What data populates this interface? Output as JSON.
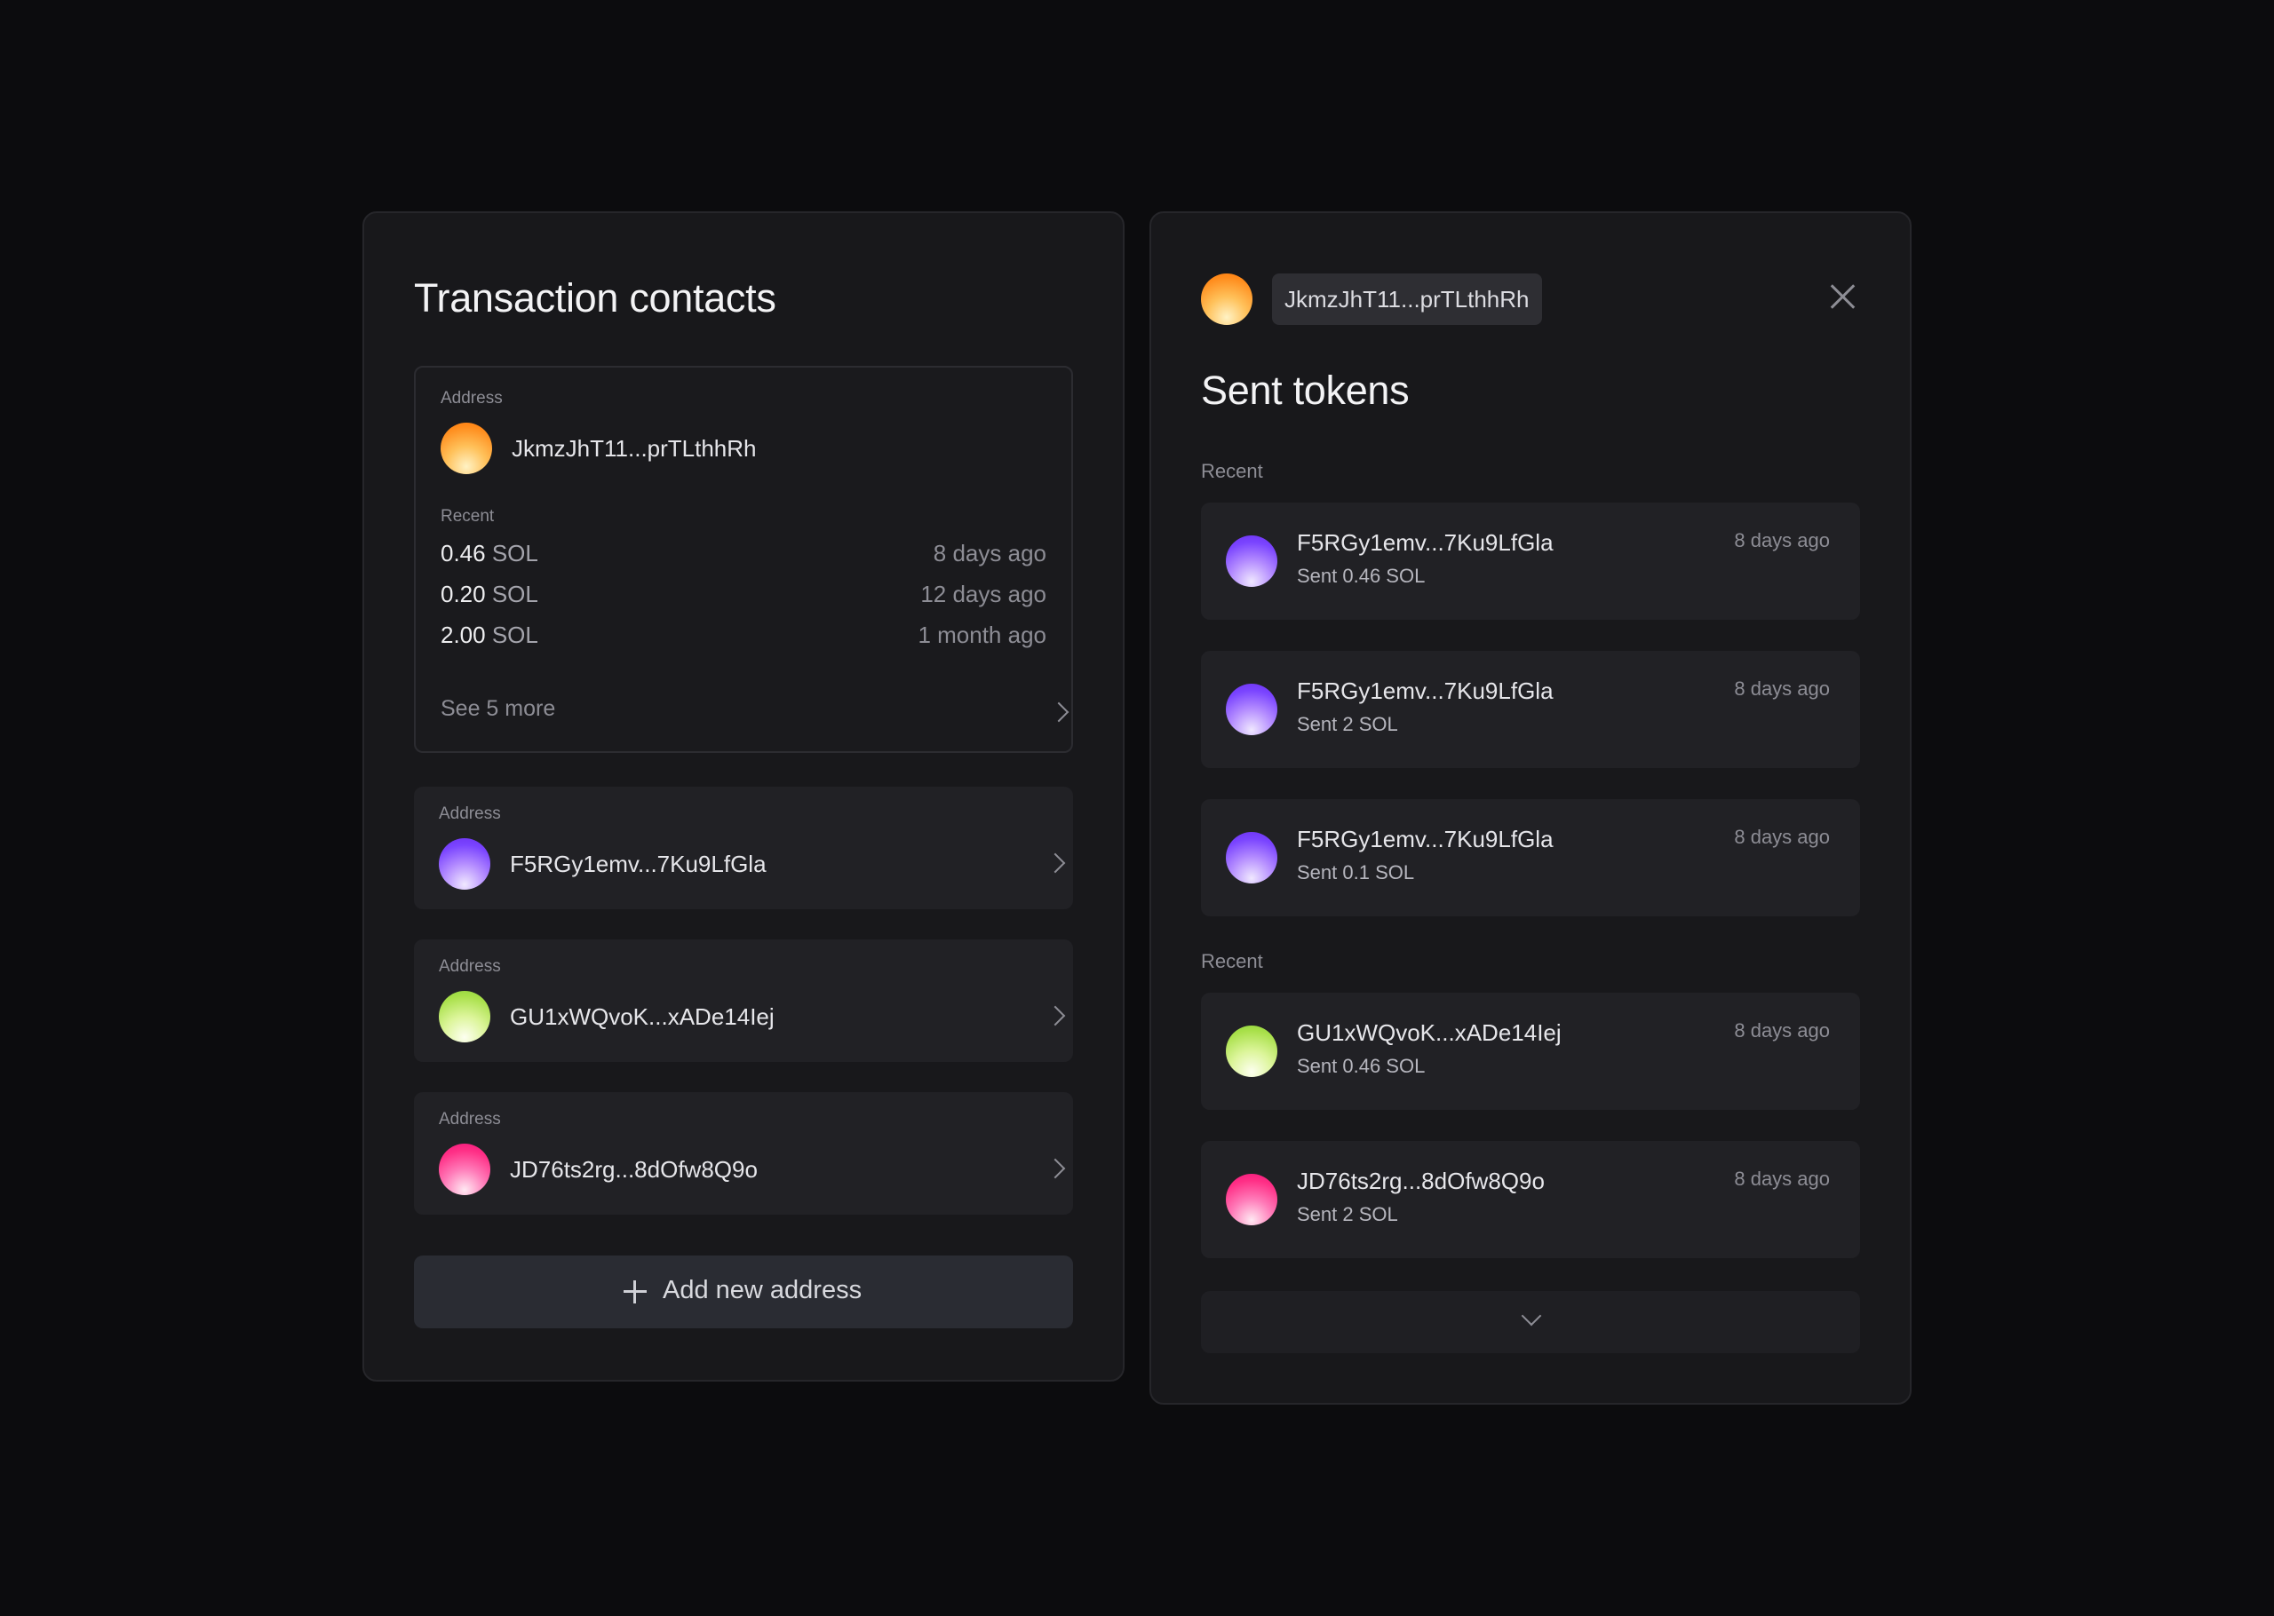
{
  "contacts_panel": {
    "title": "Transaction contacts",
    "expanded_contact": {
      "address_label": "Address",
      "address": "JkmzJhT11...prTLthhRh",
      "avatar_color": "#ff9a2e",
      "recent_label": "Recent",
      "recent": [
        {
          "amount": "0.46",
          "unit": "SOL",
          "time": "8 days ago"
        },
        {
          "amount": "0.20",
          "unit": "SOL",
          "time": "12 days ago"
        },
        {
          "amount": "2.00",
          "unit": "SOL",
          "time": "1 month ago"
        }
      ],
      "see_more": "See 5 more"
    },
    "contacts": [
      {
        "address_label": "Address",
        "address": "F5RGy1emv...7Ku9LfGla",
        "avatar_color": "#8a55ff"
      },
      {
        "address_label": "Address",
        "address": "GU1xWQvoK...xADe14Iej",
        "avatar_color": "#b5e35a"
      },
      {
        "address_label": "Address",
        "address": "JD76ts2rg...8dOfw8Q9o",
        "avatar_color": "#ff2f86"
      }
    ],
    "add_button": "Add new address"
  },
  "detail_panel": {
    "address": "JkmzJhT11...prTLthhRh",
    "avatar_color": "#ff9a2e",
    "title": "Sent tokens",
    "groups": [
      {
        "label": "Recent",
        "items": [
          {
            "address": "F5RGy1emv...7Ku9LfGla",
            "sent": "Sent 0.46 SOL",
            "time": "8 days ago",
            "avatar_color": "#8a55ff"
          },
          {
            "address": "F5RGy1emv...7Ku9LfGla",
            "sent": "Sent 2 SOL",
            "time": "8 days ago",
            "avatar_color": "#8a55ff"
          },
          {
            "address": "F5RGy1emv...7Ku9LfGla",
            "sent": "Sent 0.1 SOL",
            "time": "8 days ago",
            "avatar_color": "#8a55ff"
          }
        ]
      },
      {
        "label": "Recent",
        "items": [
          {
            "address": "GU1xWQvoK...xADe14Iej",
            "sent": "Sent 0.46 SOL",
            "time": "8 days ago",
            "avatar_color": "#b5e35a"
          },
          {
            "address": "JD76ts2rg...8dOfw8Q9o",
            "sent": "Sent 2 SOL",
            "time": "8 days ago",
            "avatar_color": "#ff2f86"
          }
        ]
      }
    ]
  },
  "colors": {
    "background": "#0c0c0e",
    "panel": "#18181b",
    "card": "#212125",
    "button": "#2a2c33"
  },
  "icons": [
    "plus-icon",
    "chevron-right-icon",
    "chevron-down-icon",
    "close-icon"
  ]
}
